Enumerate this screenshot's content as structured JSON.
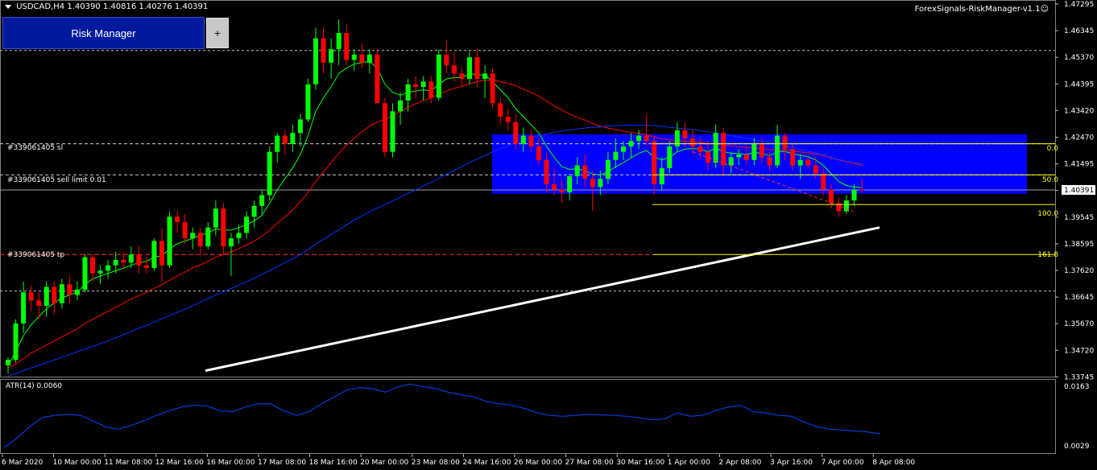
{
  "header": {
    "symbol_info": "USDCAD,H4  1.40390 1.40816 1.40276 1.40391",
    "ea_name": "ForexSignals-RiskManager-v1.1"
  },
  "risk_manager": {
    "label": "Risk Manager",
    "plus_label": "+"
  },
  "orders": {
    "sl_label": "#339061405 sl",
    "entry_label": "#339061405 sell limit 0.01",
    "tp_label": "#339061405 tp"
  },
  "fib_levels": [
    "0.0",
    "50.0",
    "100.0",
    "161.8"
  ],
  "current_price": "1.40391",
  "price_axis_labels": [
    "1.47295",
    "1.46345",
    "1.45370",
    "1.44395",
    "1.43420",
    "1.42470",
    "1.41495",
    "1.40520",
    "1.39545",
    "1.38595",
    "1.37620",
    "1.36645",
    "1.35670",
    "1.34720",
    "1.33745"
  ],
  "atr": {
    "label": "ATR(14) 0.0060",
    "max_label": "0.0163",
    "min_label": "0.0029"
  },
  "time_axis_labels": [
    "6 Mar 2020",
    "10 Mar 00:00",
    "11 Mar 08:00",
    "12 Mar 16:00",
    "16 Mar 00:00",
    "17 Mar 08:00",
    "18 Mar 16:00",
    "20 Mar 00:00",
    "23 Mar 08:00",
    "24 Mar 16:00",
    "26 Mar 00:00",
    "27 Mar 08:00",
    "30 Mar 16:00",
    "1 Apr 00:00",
    "2 Apr 08:00",
    "3 Apr 16:00",
    "7 Apr 00:00",
    "8 Apr 08:00"
  ],
  "colors": {
    "background": "#000000",
    "bull": "#00ff00",
    "bear": "#ff0000",
    "ma_fast": "#00ff00",
    "ma_mid": "#ff0000",
    "ma_slow": "#0033ff",
    "ma_long": "#ffffff",
    "zone": "#0000ff",
    "fib": "#ffff00",
    "atr": "#0047ff"
  },
  "chart_data": {
    "type": "candlestick",
    "symbol": "USDCAD",
    "timeframe": "H4",
    "ylim": [
      1.3345,
      1.4742
    ],
    "candles": [
      [
        1.339,
        1.342,
        1.336,
        1.341
      ],
      [
        1.341,
        1.356,
        1.34,
        1.3545
      ],
      [
        1.3545,
        1.37,
        1.351,
        1.366
      ],
      [
        1.366,
        1.3685,
        1.359,
        1.363
      ],
      [
        1.363,
        1.366,
        1.356,
        1.361
      ],
      [
        1.361,
        1.37,
        1.357,
        1.368
      ],
      [
        1.368,
        1.37,
        1.358,
        1.362
      ],
      [
        1.362,
        1.371,
        1.36,
        1.369
      ],
      [
        1.369,
        1.372,
        1.362,
        1.365
      ],
      [
        1.365,
        1.37,
        1.363,
        1.367
      ],
      [
        1.367,
        1.38,
        1.366,
        1.379
      ],
      [
        1.379,
        1.38,
        1.37,
        1.373
      ],
      [
        1.373,
        1.376,
        1.369,
        1.374
      ],
      [
        1.374,
        1.378,
        1.371,
        1.376
      ],
      [
        1.376,
        1.381,
        1.373,
        1.378
      ],
      [
        1.378,
        1.381,
        1.375,
        1.377
      ],
      [
        1.377,
        1.383,
        1.375,
        1.38
      ],
      [
        1.38,
        1.383,
        1.373,
        1.376
      ],
      [
        1.376,
        1.379,
        1.373,
        1.375
      ],
      [
        1.375,
        1.386,
        1.374,
        1.385
      ],
      [
        1.385,
        1.39,
        1.37,
        1.376
      ],
      [
        1.376,
        1.396,
        1.375,
        1.394
      ],
      [
        1.394,
        1.396,
        1.388,
        1.392
      ],
      [
        1.392,
        1.395,
        1.384,
        1.386
      ],
      [
        1.386,
        1.39,
        1.382,
        1.388
      ],
      [
        1.388,
        1.39,
        1.38,
        1.383
      ],
      [
        1.383,
        1.392,
        1.382,
        1.39
      ],
      [
        1.39,
        1.4,
        1.387,
        1.397
      ],
      [
        1.397,
        1.399,
        1.38,
        1.383
      ],
      [
        1.383,
        1.388,
        1.372,
        1.386
      ],
      [
        1.386,
        1.391,
        1.384,
        1.388
      ],
      [
        1.388,
        1.396,
        1.386,
        1.394
      ],
      [
        1.394,
        1.4,
        1.39,
        1.398
      ],
      [
        1.398,
        1.404,
        1.395,
        1.402
      ],
      [
        1.402,
        1.42,
        1.4,
        1.418
      ],
      [
        1.418,
        1.425,
        1.414,
        1.424
      ],
      [
        1.424,
        1.426,
        1.417,
        1.421
      ],
      [
        1.421,
        1.428,
        1.418,
        1.425
      ],
      [
        1.425,
        1.432,
        1.42,
        1.43
      ],
      [
        1.43,
        1.445,
        1.429,
        1.443
      ],
      [
        1.443,
        1.464,
        1.441,
        1.46
      ],
      [
        1.46,
        1.464,
        1.447,
        1.451
      ],
      [
        1.451,
        1.46,
        1.445,
        1.456
      ],
      [
        1.456,
        1.467,
        1.45,
        1.462
      ],
      [
        1.462,
        1.465,
        1.45,
        1.452
      ],
      [
        1.452,
        1.456,
        1.448,
        1.454
      ],
      [
        1.454,
        1.458,
        1.449,
        1.451
      ],
      [
        1.451,
        1.456,
        1.447,
        1.454
      ],
      [
        1.454,
        1.456,
        1.44,
        1.436
      ],
      [
        1.436,
        1.438,
        1.416,
        1.418
      ],
      [
        1.418,
        1.436,
        1.416,
        1.433
      ],
      [
        1.433,
        1.44,
        1.428,
        1.437
      ],
      [
        1.437,
        1.445,
        1.433,
        1.443
      ],
      [
        1.443,
        1.446,
        1.438,
        1.442
      ],
      [
        1.442,
        1.446,
        1.437,
        1.444
      ],
      [
        1.444,
        1.446,
        1.436,
        1.438
      ],
      [
        1.438,
        1.456,
        1.437,
        1.454
      ],
      [
        1.454,
        1.459,
        1.447,
        1.45
      ],
      [
        1.45,
        1.455,
        1.444,
        1.447
      ],
      [
        1.447,
        1.449,
        1.442,
        1.445
      ],
      [
        1.445,
        1.455,
        1.443,
        1.453
      ],
      [
        1.453,
        1.456,
        1.442,
        1.445
      ],
      [
        1.445,
        1.45,
        1.438,
        1.447
      ],
      [
        1.447,
        1.449,
        1.434,
        1.436
      ],
      [
        1.436,
        1.438,
        1.428,
        1.431
      ],
      [
        1.431,
        1.434,
        1.426,
        1.429
      ],
      [
        1.429,
        1.432,
        1.419,
        1.421
      ],
      [
        1.421,
        1.427,
        1.418,
        1.424
      ],
      [
        1.424,
        1.426,
        1.418,
        1.42
      ],
      [
        1.42,
        1.423,
        1.413,
        1.415
      ],
      [
        1.415,
        1.418,
        1.403,
        1.406
      ],
      [
        1.406,
        1.412,
        1.402,
        1.404
      ],
      [
        1.404,
        1.408,
        1.399,
        1.403
      ],
      [
        1.403,
        1.41,
        1.4,
        1.409
      ],
      [
        1.409,
        1.416,
        1.406,
        1.413
      ],
      [
        1.413,
        1.417,
        1.405,
        1.408
      ],
      [
        1.408,
        1.411,
        1.396,
        1.405
      ],
      [
        1.405,
        1.411,
        1.402,
        1.408
      ],
      [
        1.408,
        1.418,
        1.406,
        1.415
      ],
      [
        1.415,
        1.423,
        1.412,
        1.418
      ],
      [
        1.418,
        1.422,
        1.415,
        1.42
      ],
      [
        1.42,
        1.425,
        1.416,
        1.422
      ],
      [
        1.422,
        1.426,
        1.419,
        1.424
      ],
      [
        1.424,
        1.432,
        1.42,
        1.422
      ],
      [
        1.422,
        1.424,
        1.402,
        1.406
      ],
      [
        1.406,
        1.416,
        1.404,
        1.412
      ],
      [
        1.412,
        1.422,
        1.41,
        1.42
      ],
      [
        1.42,
        1.429,
        1.418,
        1.426
      ],
      [
        1.426,
        1.429,
        1.42,
        1.423
      ],
      [
        1.423,
        1.426,
        1.417,
        1.42
      ],
      [
        1.42,
        1.423,
        1.416,
        1.418
      ],
      [
        1.418,
        1.422,
        1.411,
        1.414
      ],
      [
        1.414,
        1.428,
        1.412,
        1.425
      ],
      [
        1.425,
        1.427,
        1.409,
        1.413
      ],
      [
        1.413,
        1.418,
        1.41,
        1.416
      ],
      [
        1.416,
        1.419,
        1.413,
        1.417
      ],
      [
        1.417,
        1.42,
        1.413,
        1.415
      ],
      [
        1.415,
        1.423,
        1.413,
        1.421
      ],
      [
        1.421,
        1.423,
        1.414,
        1.416
      ],
      [
        1.416,
        1.418,
        1.411,
        1.413
      ],
      [
        1.413,
        1.428,
        1.412,
        1.424
      ],
      [
        1.424,
        1.425,
        1.415,
        1.419
      ],
      [
        1.419,
        1.421,
        1.411,
        1.413
      ],
      [
        1.413,
        1.417,
        1.408,
        1.415
      ],
      [
        1.415,
        1.417,
        1.412,
        1.413
      ],
      [
        1.413,
        1.416,
        1.408,
        1.41
      ],
      [
        1.41,
        1.412,
        1.402,
        1.404
      ],
      [
        1.404,
        1.406,
        1.397,
        1.399
      ],
      [
        1.399,
        1.401,
        1.394,
        1.396
      ],
      [
        1.396,
        1.402,
        1.395,
        1.4
      ],
      [
        1.4,
        1.406,
        1.398,
        1.404
      ],
      [
        1.404,
        1.4082,
        1.4028,
        1.4039
      ]
    ],
    "moving_averages": [
      {
        "color": "#00ff00",
        "values": [
          1.339,
          1.344,
          1.35,
          1.354,
          1.357,
          1.36,
          1.362,
          1.364,
          1.365,
          1.366,
          1.369,
          1.371,
          1.372,
          1.373,
          1.374,
          1.375,
          1.376,
          1.377,
          1.3775,
          1.379,
          1.3795,
          1.382,
          1.384,
          1.385,
          1.386,
          1.387,
          1.388,
          1.3895,
          1.389,
          1.389,
          1.39,
          1.391,
          1.3925,
          1.3945,
          1.399,
          1.404,
          1.408,
          1.412,
          1.417,
          1.424,
          1.433,
          1.438,
          1.442,
          1.447,
          1.449,
          1.4505,
          1.451,
          1.4515,
          1.449,
          1.443,
          1.44,
          1.439,
          1.44,
          1.4405,
          1.441,
          1.4405,
          1.443,
          1.445,
          1.4455,
          1.4455,
          1.447,
          1.4465,
          1.4465,
          1.444,
          1.441,
          1.438,
          1.434,
          1.431,
          1.428,
          1.425,
          1.42,
          1.416,
          1.4125,
          1.4115,
          1.4118,
          1.411,
          1.4098,
          1.4094,
          1.4106,
          1.4125,
          1.414,
          1.4158,
          1.4175,
          1.4185,
          1.416,
          1.415,
          1.416,
          1.418,
          1.419,
          1.4192,
          1.419,
          1.418,
          1.4195,
          1.418,
          1.4175,
          1.4174,
          1.417,
          1.4178,
          1.4174,
          1.4166,
          1.418,
          1.4182,
          1.4172,
          1.4168,
          1.4162,
          1.415,
          1.413,
          1.41,
          1.407,
          1.4055,
          1.405,
          1.4047
        ]
      },
      {
        "color": "#ff0000",
        "values": [
          1.338,
          1.3395,
          1.3415,
          1.3435,
          1.345,
          1.3465,
          1.348,
          1.3495,
          1.351,
          1.3525,
          1.3545,
          1.356,
          1.3575,
          1.359,
          1.3605,
          1.362,
          1.3635,
          1.3648,
          1.366,
          1.3675,
          1.3688,
          1.3705,
          1.372,
          1.3735,
          1.375,
          1.3762,
          1.3775,
          1.379,
          1.38,
          1.381,
          1.3822,
          1.3835,
          1.385,
          1.3868,
          1.389,
          1.3915,
          1.394,
          1.3965,
          1.3995,
          1.403,
          1.407,
          1.4105,
          1.414,
          1.4175,
          1.4205,
          1.423,
          1.4255,
          1.4275,
          1.429,
          1.43,
          1.4315,
          1.433,
          1.4345,
          1.4358,
          1.437,
          1.438,
          1.4393,
          1.4405,
          1.4415,
          1.4423,
          1.4432,
          1.444,
          1.4445,
          1.4445,
          1.444,
          1.4433,
          1.4425,
          1.4412,
          1.44,
          1.4386,
          1.4368,
          1.435,
          1.4335,
          1.432,
          1.4308,
          1.4298,
          1.4285,
          1.4275,
          1.4268,
          1.4262,
          1.4257,
          1.4252,
          1.4248,
          1.4244,
          1.4235,
          1.4228,
          1.4224,
          1.4222,
          1.422,
          1.4218,
          1.4215,
          1.421,
          1.4208,
          1.4205,
          1.4202,
          1.4199,
          1.4196,
          1.4194,
          1.4192,
          1.4188,
          1.4187,
          1.4186,
          1.4183,
          1.418,
          1.4177,
          1.4172,
          1.4166,
          1.4158,
          1.415,
          1.4143,
          1.4137,
          1.4131
        ]
      },
      {
        "color": "#0033ff",
        "values": [
          1.335,
          1.336,
          1.337,
          1.338,
          1.339,
          1.34,
          1.341,
          1.342,
          1.343,
          1.344,
          1.345,
          1.346,
          1.347,
          1.348,
          1.3492,
          1.3503,
          1.3515,
          1.3527,
          1.3538,
          1.355,
          1.3562,
          1.3574,
          1.3586,
          1.3598,
          1.3611,
          1.3624,
          1.3637,
          1.365,
          1.3662,
          1.3674,
          1.3687,
          1.37,
          1.3713,
          1.3726,
          1.374,
          1.3755,
          1.377,
          1.3785,
          1.38,
          1.3818,
          1.3838,
          1.3856,
          1.3874,
          1.3892,
          1.391,
          1.3927,
          1.3943,
          1.3958,
          1.3972,
          1.3985,
          1.3998,
          1.4012,
          1.4026,
          1.404,
          1.4054,
          1.4067,
          1.4082,
          1.4097,
          1.4111,
          1.4125,
          1.414,
          1.4153,
          1.4167,
          1.418,
          1.4192,
          1.4203,
          1.4214,
          1.4223,
          1.4232,
          1.424,
          1.4246,
          1.4252,
          1.4257,
          1.4261,
          1.4265,
          1.4268,
          1.4271,
          1.4273,
          1.4275,
          1.4277,
          1.4278,
          1.4279,
          1.4279,
          1.4279,
          1.4277,
          1.4274,
          1.4271,
          1.4268,
          1.4265,
          1.4262,
          1.4258,
          1.4254,
          1.425,
          1.4246,
          1.4241,
          1.4236,
          1.423,
          1.4225,
          1.422,
          1.4214,
          1.4209,
          1.4203,
          1.4197,
          1.419,
          1.4183,
          1.4176,
          1.4168,
          1.416,
          1.4152,
          1.4145,
          1.414,
          1.4135
        ]
      }
    ],
    "long_ma": {
      "color": "#ffffff",
      "start": 1.337,
      "end": 1.39
    },
    "fib": {
      "levels": [
        0.0,
        50.0,
        100.0,
        161.8
      ],
      "prices": [
        1.421,
        1.4095,
        1.3985,
        1.38
      ]
    },
    "zone": {
      "top": 1.4245,
      "bottom": 1.4025
    },
    "order_lines": {
      "sl": 1.421,
      "entry": 1.4095,
      "tp": 1.38
    },
    "horizontal_lines": [
      1.4555,
      1.3665
    ],
    "atr": {
      "ylim": [
        0.0025,
        0.017
      ],
      "values": [
        0.003,
        0.005,
        0.0075,
        0.0095,
        0.01,
        0.0102,
        0.01,
        0.0088,
        0.0075,
        0.007,
        0.0078,
        0.0088,
        0.01,
        0.011,
        0.0118,
        0.0122,
        0.012,
        0.011,
        0.0108,
        0.0118,
        0.0125,
        0.0125,
        0.011,
        0.01,
        0.0108,
        0.0125,
        0.014,
        0.0155,
        0.016,
        0.0158,
        0.015,
        0.0162,
        0.0168,
        0.0162,
        0.0158,
        0.015,
        0.0145,
        0.014,
        0.013,
        0.0125,
        0.0122,
        0.0115,
        0.0105,
        0.01,
        0.0098,
        0.01,
        0.0102,
        0.0101,
        0.01,
        0.0098,
        0.0095,
        0.009,
        0.0092,
        0.0105,
        0.0098,
        0.01,
        0.011,
        0.0118,
        0.0122,
        0.0108,
        0.0105,
        0.01,
        0.0098,
        0.0085,
        0.0075,
        0.007,
        0.0068,
        0.0066,
        0.0064,
        0.006
      ]
    }
  }
}
